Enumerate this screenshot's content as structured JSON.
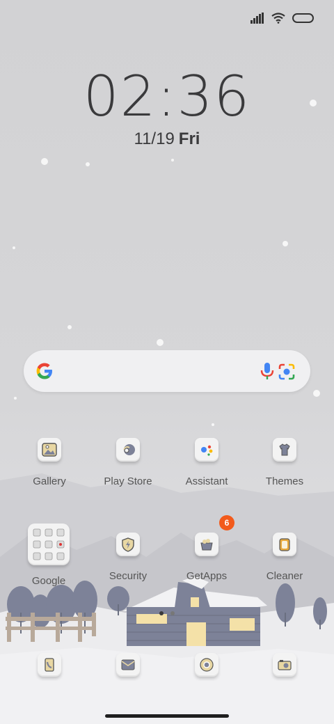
{
  "status_bar": {
    "icons": [
      "signal-icon",
      "wifi-icon",
      "battery-icon"
    ]
  },
  "lock": {
    "time": "02:36",
    "date": "11/19",
    "day": "Fri"
  },
  "search_widget": {
    "icons": [
      "google-logo-icon",
      "microphone-icon",
      "lens-camera-icon"
    ]
  },
  "apps_row1": [
    {
      "label": "Gallery",
      "icon": "gallery-icon"
    },
    {
      "label": "Play Store",
      "icon": "play-store-icon"
    },
    {
      "label": "Assistant",
      "icon": "assistant-icon"
    },
    {
      "label": "Themes",
      "icon": "themes-icon"
    }
  ],
  "apps_row2": [
    {
      "label": "Google",
      "icon": "google-folder-icon"
    },
    {
      "label": "Security",
      "icon": "security-icon"
    },
    {
      "label": "GetApps",
      "icon": "getapps-icon",
      "badge": "6"
    },
    {
      "label": "Cleaner",
      "icon": "cleaner-icon"
    }
  ],
  "dock": [
    {
      "icon": "phone-icon"
    },
    {
      "icon": "messages-icon"
    },
    {
      "icon": "chrome-icon"
    },
    {
      "icon": "camera-icon"
    }
  ],
  "page_indicator": {
    "pages": 2,
    "current": 1
  },
  "colors": {
    "badge": "#f25a1b",
    "text": "#3a3a3c",
    "label": "#555555",
    "house": "#7d8298"
  }
}
